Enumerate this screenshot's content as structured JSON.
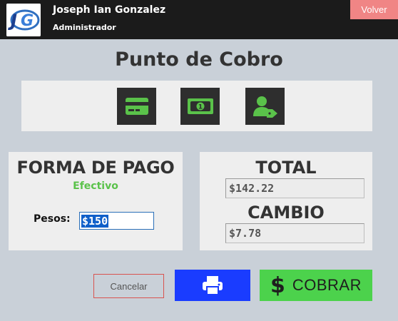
{
  "header": {
    "user_name": "Joseph Ian Gonzalez",
    "user_role": "Administrador",
    "logo_icon": "jg-logo-icon",
    "back_label": "Volver"
  },
  "page": {
    "title": "Punto de Cobro"
  },
  "payment_methods": [
    {
      "icon": "credit-card-icon",
      "accent": "#5ac24a"
    },
    {
      "icon": "cash-icon",
      "accent": "#5ac24a"
    },
    {
      "icon": "user-tag-icon",
      "accent": "#5ac24a"
    }
  ],
  "payment_form": {
    "title": "FORMA DE PAGO",
    "method": "Efectivo",
    "pesos_label": "Pesos:",
    "pesos_value": "$150"
  },
  "totals": {
    "total_label": "TOTAL",
    "total_value": "$142.22",
    "change_label": "CAMBIO",
    "change_value": "$7.78"
  },
  "actions": {
    "cancel_label": "Cancelar",
    "print_icon": "printer-icon",
    "charge_symbol": "$",
    "charge_label": "COBRAR"
  },
  "colors": {
    "background": "#c9d0d8",
    "topbar": "#1b1b1b",
    "back_button": "#f08585",
    "accent_green": "#4cd24c",
    "print_blue": "#1a3cff",
    "cancel_border": "#d9534f"
  }
}
